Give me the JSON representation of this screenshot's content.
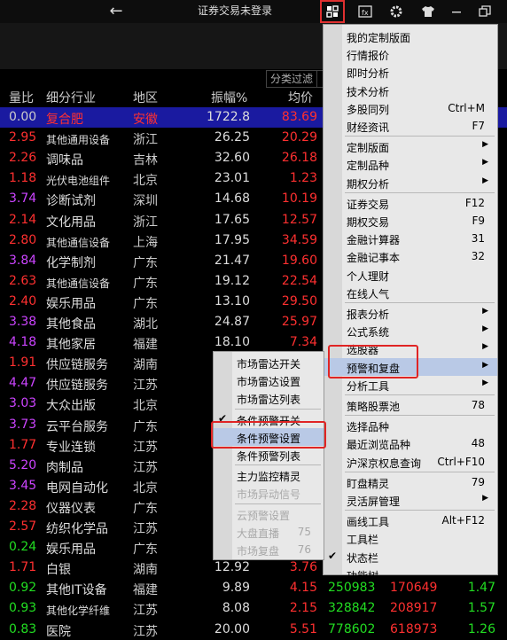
{
  "titlebar": {
    "back_icon": "←",
    "title": "证券交易未登录",
    "icons": [
      "layout-icon",
      "fx-icon",
      "gear-icon",
      "shirt-icon",
      "minimize-icon",
      "restore-icon"
    ]
  },
  "filter": {
    "label": "分类过滤"
  },
  "columns": {
    "ratio": "量比",
    "industry": "细分行业",
    "region": "地区",
    "amplitude": "振幅%",
    "avg": "均价"
  },
  "rows": [
    {
      "ratio": "0.00",
      "industry": "复合肥",
      "region": "安徽",
      "amp": "1722.8",
      "avg": "83.69",
      "rc": "#cccccc",
      "ac": "#ff3030",
      "sel": true,
      "small": false
    },
    {
      "ratio": "2.95",
      "industry": "其他通用设备",
      "region": "浙江",
      "amp": "26.25",
      "avg": "20.29",
      "rc": "#ff3030",
      "ac": "#ff3030",
      "small": true
    },
    {
      "ratio": "2.26",
      "industry": "调味品",
      "region": "吉林",
      "amp": "32.60",
      "avg": "26.18",
      "rc": "#ff3030",
      "ac": "#ff3030",
      "small": false
    },
    {
      "ratio": "1.18",
      "industry": "光伏电池组件",
      "region": "北京",
      "amp": "23.01",
      "avg": "1.23",
      "rc": "#ff3030",
      "ac": "#ff3030",
      "small": true
    },
    {
      "ratio": "3.74",
      "industry": "诊断试剂",
      "region": "深圳",
      "amp": "14.68",
      "avg": "10.19",
      "rc": "#cc44ff",
      "ac": "#ff3030",
      "small": false
    },
    {
      "ratio": "2.14",
      "industry": "文化用品",
      "region": "浙江",
      "amp": "17.65",
      "avg": "12.57",
      "rc": "#ff3030",
      "ac": "#ff3030",
      "small": false
    },
    {
      "ratio": "2.80",
      "industry": "其他通信设备",
      "region": "上海",
      "amp": "17.95",
      "avg": "34.59",
      "rc": "#ff3030",
      "ac": "#ff3030",
      "small": true
    },
    {
      "ratio": "3.84",
      "industry": "化学制剂",
      "region": "广东",
      "amp": "21.47",
      "avg": "19.60",
      "rc": "#cc44ff",
      "ac": "#ff3030",
      "small": false
    },
    {
      "ratio": "2.63",
      "industry": "其他通信设备",
      "region": "广东",
      "amp": "19.12",
      "avg": "22.54",
      "rc": "#ff3030",
      "ac": "#ff3030",
      "small": true
    },
    {
      "ratio": "2.40",
      "industry": "娱乐用品",
      "region": "广东",
      "amp": "13.10",
      "avg": "29.50",
      "rc": "#ff3030",
      "ac": "#ff3030",
      "small": false
    },
    {
      "ratio": "3.38",
      "industry": "其他食品",
      "region": "湖北",
      "amp": "24.87",
      "avg": "25.97",
      "rc": "#cc44ff",
      "ac": "#ff3030",
      "small": false
    },
    {
      "ratio": "4.18",
      "industry": "其他家居",
      "region": "福建",
      "amp": "18.10",
      "avg": "7.34",
      "rc": "#cc44ff",
      "ac": "#ff3030",
      "small": false
    },
    {
      "ratio": "1.91",
      "industry": "供应链服务",
      "region": "湖南",
      "amp": "",
      "avg": "",
      "rc": "#ff3030",
      "ac": "#ff3030",
      "small": false
    },
    {
      "ratio": "4.47",
      "industry": "供应链服务",
      "region": "江苏",
      "amp": "",
      "avg": "",
      "rc": "#cc44ff",
      "ac": "#ff3030",
      "small": false
    },
    {
      "ratio": "3.03",
      "industry": "大众出版",
      "region": "北京",
      "amp": "",
      "avg": "",
      "rc": "#cc44ff",
      "ac": "#ff3030",
      "small": false
    },
    {
      "ratio": "3.73",
      "industry": "云平台服务",
      "region": "广东",
      "amp": "",
      "avg": "",
      "rc": "#cc44ff",
      "ac": "#ff3030",
      "small": false
    },
    {
      "ratio": "1.77",
      "industry": "专业连锁",
      "region": "江苏",
      "amp": "",
      "avg": "",
      "rc": "#ff3030",
      "ac": "#ff3030",
      "small": false
    },
    {
      "ratio": "5.20",
      "industry": "肉制品",
      "region": "江苏",
      "amp": "",
      "avg": "",
      "rc": "#cc44ff",
      "ac": "#ff3030",
      "small": false
    },
    {
      "ratio": "3.45",
      "industry": "电网自动化",
      "region": "北京",
      "amp": "",
      "avg": "",
      "rc": "#cc44ff",
      "ac": "#ff3030",
      "small": false
    },
    {
      "ratio": "2.28",
      "industry": "仪器仪表",
      "region": "广东",
      "amp": "",
      "avg": "",
      "rc": "#ff3030",
      "ac": "#ff3030",
      "small": false
    },
    {
      "ratio": "2.57",
      "industry": "纺织化学品",
      "region": "江苏",
      "amp": "",
      "avg": "",
      "rc": "#ff3030",
      "ac": "#ff3030",
      "small": false
    },
    {
      "ratio": "0.24",
      "industry": "娱乐用品",
      "region": "广东",
      "amp": "",
      "avg": "",
      "rc": "#22dd22",
      "ac": "#ff3030",
      "small": false
    },
    {
      "ratio": "1.71",
      "industry": "白银",
      "region": "湖南",
      "amp": "12.92",
      "avg": "3.76",
      "rc": "#ff3030",
      "ac": "#ff3030",
      "small": false
    },
    {
      "ratio": "0.92",
      "industry": "其他IT设备",
      "region": "福建",
      "amp": "9.89",
      "avg": "4.15",
      "rc": "#22dd22",
      "ac": "#ff3030",
      "small": false,
      "x1": "250983",
      "x2": "170649",
      "x3": "1.47"
    },
    {
      "ratio": "0.93",
      "industry": "其他化学纤维",
      "region": "江苏",
      "amp": "8.08",
      "avg": "2.15",
      "rc": "#22dd22",
      "ac": "#ff3030",
      "small": true,
      "x1": "328842",
      "x2": "208917",
      "x3": "1.57"
    },
    {
      "ratio": "0.83",
      "industry": "医院",
      "region": "江苏",
      "amp": "20.00",
      "avg": "5.51",
      "rc": "#22dd22",
      "ac": "#ff3030",
      "small": false,
      "x1": "778602",
      "x2": "618973",
      "x3": "1.26"
    }
  ],
  "main_menu": {
    "items": [
      {
        "label": "我的定制版面",
        "sc": "",
        "arrow": false
      },
      {
        "label": "行情报价",
        "sc": "",
        "arrow": false
      },
      {
        "label": "即时分析",
        "sc": "",
        "arrow": false
      },
      {
        "label": "技术分析",
        "sc": "",
        "arrow": false
      },
      {
        "label": "多股同列",
        "sc": "Ctrl+M",
        "arrow": false
      },
      {
        "label": "财经资讯",
        "sc": "F7",
        "arrow": false,
        "sep_after": true
      },
      {
        "label": "定制版面",
        "sc": "",
        "arrow": true
      },
      {
        "label": "定制品种",
        "sc": "",
        "arrow": true
      },
      {
        "label": "期权分析",
        "sc": "",
        "arrow": true,
        "sep_after": true
      },
      {
        "label": "证券交易",
        "sc": "F12",
        "arrow": false
      },
      {
        "label": "期权交易",
        "sc": "F9",
        "arrow": false
      },
      {
        "label": "金融计算器",
        "sc": "31",
        "arrow": false
      },
      {
        "label": "金融记事本",
        "sc": "32",
        "arrow": false
      },
      {
        "label": "个人理财",
        "sc": "",
        "arrow": false
      },
      {
        "label": "在线人气",
        "sc": "",
        "arrow": false,
        "sep_after": true
      },
      {
        "label": "报表分析",
        "sc": "",
        "arrow": true
      },
      {
        "label": "公式系统",
        "sc": "",
        "arrow": true
      },
      {
        "label": "选股器",
        "sc": "",
        "arrow": true
      },
      {
        "label": "预警和复盘",
        "sc": "",
        "arrow": true,
        "hover": true
      },
      {
        "label": "分析工具",
        "sc": "",
        "arrow": true,
        "sep_after": true
      },
      {
        "label": "策略股票池",
        "sc": "78",
        "arrow": false,
        "sep_after": true
      },
      {
        "label": "选择品种",
        "sc": "",
        "arrow": false
      },
      {
        "label": "最近浏览品种",
        "sc": "48",
        "arrow": false
      },
      {
        "label": "沪深京权息查询",
        "sc": "Ctrl+F10",
        "arrow": false,
        "sep_after": true
      },
      {
        "label": "盯盘精灵",
        "sc": "79",
        "arrow": false
      },
      {
        "label": "灵活屏管理",
        "sc": "",
        "arrow": true,
        "sep_after": true
      },
      {
        "label": "画线工具",
        "sc": "Alt+F12",
        "arrow": false
      },
      {
        "label": "工具栏",
        "sc": "",
        "arrow": false
      },
      {
        "label": "状态栏",
        "sc": "",
        "arrow": false,
        "checked": true
      },
      {
        "label": "功能树",
        "sc": "",
        "arrow": false
      }
    ]
  },
  "sub_menu": {
    "items": [
      {
        "label": "市场雷达开关",
        "sc": "",
        "dis": false
      },
      {
        "label": "市场雷达设置",
        "sc": "",
        "dis": false
      },
      {
        "label": "市场雷达列表",
        "sc": "",
        "dis": false,
        "sep_after": true
      },
      {
        "label": "条件预警开关",
        "sc": "",
        "dis": false,
        "checked": true
      },
      {
        "label": "条件预警设置",
        "sc": "",
        "dis": false,
        "hover": true
      },
      {
        "label": "条件预警列表",
        "sc": "",
        "dis": false,
        "sep_after": true
      },
      {
        "label": "主力监控精灵",
        "sc": "",
        "dis": false
      },
      {
        "label": "市场异动信号",
        "sc": "",
        "dis": true,
        "sep_after": true
      },
      {
        "label": "云预警设置",
        "sc": "",
        "dis": true
      },
      {
        "label": "大盘直播",
        "sc": "75",
        "dis": true
      },
      {
        "label": "市场复盘",
        "sc": "76",
        "dis": true
      }
    ]
  }
}
